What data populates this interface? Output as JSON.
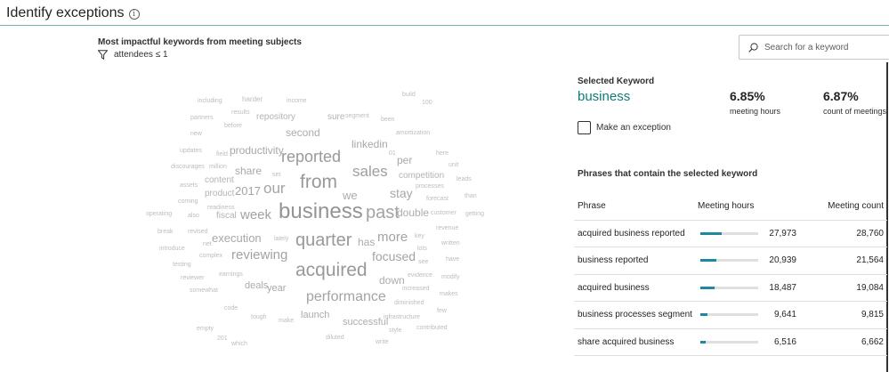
{
  "header": {
    "title": "Identify exceptions",
    "info_icon": "info-icon"
  },
  "cloud_panel": {
    "heading": "Most impactful keywords from meeting subjects",
    "filter": "attendees ≤ 1",
    "words": [
      {
        "text": "including",
        "color": "#bdbdbd"
      },
      {
        "text": "harder",
        "color": "#bdbdbd"
      },
      {
        "text": "income",
        "color": "#bdbdbd"
      },
      {
        "text": "build",
        "color": "#bdbdbd"
      },
      {
        "text": "100",
        "color": "#bdbdbd"
      },
      {
        "text": "results",
        "color": "#bdbdbd"
      },
      {
        "text": "partners",
        "color": "#bdbdbd"
      },
      {
        "text": "repository",
        "color": "#b3b3b3"
      },
      {
        "text": "sure",
        "color": "#b3b3b3"
      },
      {
        "text": "segment",
        "color": "#bdbdbd"
      },
      {
        "text": "been",
        "color": "#bdbdbd"
      },
      {
        "text": "before",
        "color": "#bdbdbd"
      },
      {
        "text": "new",
        "color": "#bdbdbd"
      },
      {
        "text": "second",
        "color": "#acacac"
      },
      {
        "text": "amortization",
        "color": "#bdbdbd"
      },
      {
        "text": "linkedin",
        "color": "#a8a8a8"
      },
      {
        "text": "productivity",
        "color": "#a8a8a8"
      },
      {
        "text": "updates",
        "color": "#bdbdbd"
      },
      {
        "text": "field",
        "color": "#bdbdbd"
      },
      {
        "text": "01",
        "color": "#bdbdbd"
      },
      {
        "text": "here",
        "color": "#bdbdbd"
      },
      {
        "text": "reported",
        "color": "#999999"
      },
      {
        "text": "per",
        "color": "#a8a8a8"
      },
      {
        "text": "discourages",
        "color": "#bdbdbd"
      },
      {
        "text": "million",
        "color": "#bdbdbd"
      },
      {
        "text": "share",
        "color": "#a8a8a8"
      },
      {
        "text": "set",
        "color": "#bdbdbd"
      },
      {
        "text": "sales",
        "color": "#9e9e9e"
      },
      {
        "text": "unit",
        "color": "#bdbdbd"
      },
      {
        "text": "competition",
        "color": "#b3b3b3"
      },
      {
        "text": "content",
        "color": "#b3b3b3"
      },
      {
        "text": "from",
        "color": "#999999"
      },
      {
        "text": "leads",
        "color": "#bdbdbd"
      },
      {
        "text": "assets",
        "color": "#bdbdbd"
      },
      {
        "text": "2017",
        "color": "#a3a3a3"
      },
      {
        "text": "our",
        "color": "#a3a3a3"
      },
      {
        "text": "processes",
        "color": "#bdbdbd"
      },
      {
        "text": "product",
        "color": "#b3b3b3"
      },
      {
        "text": "we",
        "color": "#acacac"
      },
      {
        "text": "stay",
        "color": "#a8a8a8"
      },
      {
        "text": "forecast",
        "color": "#bdbdbd"
      },
      {
        "text": "than",
        "color": "#bdbdbd"
      },
      {
        "text": "coming",
        "color": "#bdbdbd"
      },
      {
        "text": "readiness",
        "color": "#bdbdbd"
      },
      {
        "text": "operating",
        "color": "#bdbdbd"
      },
      {
        "text": "also",
        "color": "#bdbdbd"
      },
      {
        "text": "fiscal",
        "color": "#b3b3b3"
      },
      {
        "text": "week",
        "color": "#a3a3a3"
      },
      {
        "text": "business",
        "color": "#949494"
      },
      {
        "text": "past",
        "color": "#a3a3a3"
      },
      {
        "text": "double",
        "color": "#acacac"
      },
      {
        "text": "customer",
        "color": "#bdbdbd"
      },
      {
        "text": "getting",
        "color": "#bdbdbd"
      },
      {
        "text": "revenue",
        "color": "#bdbdbd"
      },
      {
        "text": "break",
        "color": "#bdbdbd"
      },
      {
        "text": "revised",
        "color": "#bdbdbd"
      },
      {
        "text": "execution",
        "color": "#a8a8a8"
      },
      {
        "text": "lately",
        "color": "#bdbdbd"
      },
      {
        "text": "quarter",
        "color": "#999999"
      },
      {
        "text": "has",
        "color": "#acacac"
      },
      {
        "text": "more",
        "color": "#a3a3a3"
      },
      {
        "text": "key",
        "color": "#bdbdbd"
      },
      {
        "text": "net",
        "color": "#bdbdbd"
      },
      {
        "text": "written",
        "color": "#bdbdbd"
      },
      {
        "text": "introduce",
        "color": "#bdbdbd"
      },
      {
        "text": "lots",
        "color": "#bdbdbd"
      },
      {
        "text": "complex",
        "color": "#bdbdbd"
      },
      {
        "text": "reviewing",
        "color": "#a3a3a3"
      },
      {
        "text": "focused",
        "color": "#a3a3a3"
      },
      {
        "text": "have",
        "color": "#bdbdbd"
      },
      {
        "text": "see",
        "color": "#bdbdbd"
      },
      {
        "text": "testing",
        "color": "#bdbdbd"
      },
      {
        "text": "acquired",
        "color": "#999999"
      },
      {
        "text": "earnings",
        "color": "#bdbdbd"
      },
      {
        "text": "evidence",
        "color": "#bdbdbd"
      },
      {
        "text": "modify",
        "color": "#bdbdbd"
      },
      {
        "text": "reviewer",
        "color": "#bdbdbd"
      },
      {
        "text": "down",
        "color": "#acacac"
      },
      {
        "text": "deals",
        "color": "#acacac"
      },
      {
        "text": "year",
        "color": "#a8a8a8"
      },
      {
        "text": "increased",
        "color": "#bdbdbd"
      },
      {
        "text": "somewhat",
        "color": "#bdbdbd"
      },
      {
        "text": "makes",
        "color": "#bdbdbd"
      },
      {
        "text": "performance",
        "color": "#a3a3a3"
      },
      {
        "text": "diminished",
        "color": "#bdbdbd"
      },
      {
        "text": "code",
        "color": "#bdbdbd"
      },
      {
        "text": "few",
        "color": "#bdbdbd"
      },
      {
        "text": "launch",
        "color": "#acacac"
      },
      {
        "text": "tough",
        "color": "#bdbdbd"
      },
      {
        "text": "infrastructure",
        "color": "#bdbdbd"
      },
      {
        "text": "make",
        "color": "#bdbdbd"
      },
      {
        "text": "successful",
        "color": "#acacac"
      },
      {
        "text": "empty",
        "color": "#bdbdbd"
      },
      {
        "text": "style",
        "color": "#bdbdbd"
      },
      {
        "text": "contributed",
        "color": "#bdbdbd"
      },
      {
        "text": "201",
        "color": "#bdbdbd"
      },
      {
        "text": "diluted",
        "color": "#bdbdbd"
      },
      {
        "text": "which",
        "color": "#bdbdbd"
      },
      {
        "text": "write",
        "color": "#bdbdbd"
      }
    ]
  },
  "search": {
    "placeholder": "Search for a keyword",
    "icon": "search-icon"
  },
  "selected": {
    "label": "Selected Keyword",
    "keyword": "business",
    "keyword_color": "#0f7b7a",
    "metric_hours_value": "6.85%",
    "metric_hours_label": "meeting hours",
    "metric_count_value": "6.87%",
    "metric_count_label": "count of meetings",
    "exception_label": "Make an exception",
    "exception_checked": false
  },
  "phrases": {
    "heading": "Phrases that contain the selected keyword",
    "columns": [
      "Phrase",
      "Meeting hours",
      "Meeting count"
    ],
    "bar_color": "#1b8a9e",
    "rows": [
      {
        "phrase": "acquired business reported",
        "hours": "27,973",
        "hours_fraction": 0.37,
        "count": "28,760"
      },
      {
        "phrase": "business reported",
        "hours": "20,939",
        "hours_fraction": 0.28,
        "count": "21,564"
      },
      {
        "phrase": "acquired business",
        "hours": "18,487",
        "hours_fraction": 0.25,
        "count": "19,084"
      },
      {
        "phrase": "business processes segment",
        "hours": "9,641",
        "hours_fraction": 0.13,
        "count": "9,815"
      },
      {
        "phrase": "share acquired business",
        "hours": "6,516",
        "hours_fraction": 0.09,
        "count": "6,662"
      }
    ]
  }
}
